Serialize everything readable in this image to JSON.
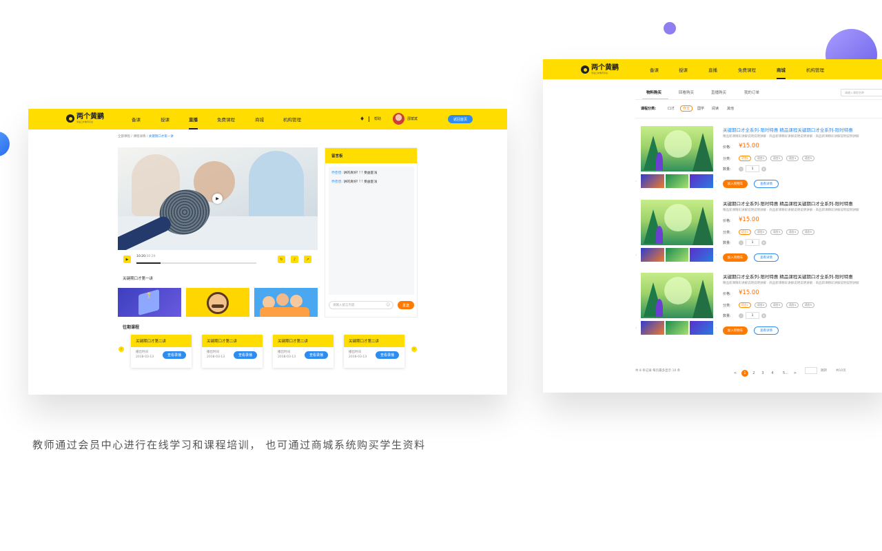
{
  "brand": {
    "name": "两个黄鹂",
    "slogan": "专注口才教育平台"
  },
  "colors": {
    "brand_yellow": "#ffdd00",
    "accent_blue": "#2d8cf0",
    "accent_orange": "#ff7a00",
    "price_orange": "#ff6a00"
  },
  "screen1": {
    "nav": {
      "items": [
        "备课",
        "授课",
        "直播",
        "免费课程",
        "商城",
        "机构管理"
      ],
      "active": "直播",
      "bell_icon": "bell-icon",
      "help": "帮助",
      "user_name": "邵斌斌",
      "home_button": "返回首页"
    },
    "breadcrumb": {
      "items": [
        "全部课程",
        "课程详情"
      ],
      "current": "关键期口才第一讲"
    },
    "video": {
      "time_current": "10:20",
      "time_total": "30:29",
      "progress": 0.2
    },
    "lesson_title": "关键期口才第一讲",
    "message_board": {
      "title": "留言板",
      "messages": [
        {
          "user": "乔佳佳:",
          "text": "讲的真好! ! ! 受益匪浅"
        },
        {
          "user": "乔佳佳:",
          "text": "讲的真好! ! ! 受益匪浅"
        }
      ],
      "input_placeholder": "请输入留言内容",
      "send_button": "发送"
    },
    "past_courses": {
      "title": "往期课程",
      "cards": [
        {
          "title": "关键期口才第二讲",
          "meta_label": "播出时间",
          "date": "2018-03-13",
          "button": "查看录播"
        },
        {
          "title": "关键期口才第二讲",
          "meta_label": "播出时间",
          "date": "2018-03-13",
          "button": "查看录播"
        },
        {
          "title": "关键期口才第二讲",
          "meta_label": "播出时间",
          "date": "2018-03-13",
          "button": "查看录播"
        },
        {
          "title": "关键期口才第二讲",
          "meta_label": "播出时间",
          "date": "2018-03-13",
          "button": "查看录播"
        }
      ]
    }
  },
  "screen2": {
    "nav": {
      "items": [
        "备课",
        "授课",
        "直播",
        "免费课程",
        "商城",
        "机构管理"
      ],
      "active": "商城"
    },
    "tabs": [
      "物料购买",
      "回看购买",
      "直播购买",
      "我的订单"
    ],
    "active_tab": "物料购买",
    "search_placeholder": "请输入课程名称",
    "category": {
      "label": "课程分类:",
      "items": [
        "口才",
        "作文",
        "国学",
        "阅读",
        "其他"
      ],
      "active": "作文"
    },
    "products": [
      {
        "title": "关键期口才全系列-限时特惠  精品课程关键期口才全系列-限时特惠",
        "highlight": true,
        "desc": "精品新课精彩讲解说明说明讲解 · 商品新课精彩讲解说明说明讲解 · 商品新课精彩讲解说明说明讲解",
        "price_label": "价格:",
        "price": "¥15.00",
        "tags_label": "分类:",
        "tags": [
          "语言1",
          "语言2",
          "语言3",
          "语言4",
          "语言5"
        ],
        "active_tag": "语言1",
        "qty_label": "数量:",
        "qty": "1",
        "add_cart": "加入购物车",
        "detail": "查看详情"
      },
      {
        "title": "关键期口才全系列-限时特惠  精品课程关键期口才全系列-限时特惠",
        "highlight": false,
        "desc": "精品新课精彩讲解说明说明讲解 · 商品新课精彩讲解说明说明讲解 · 商品新课精彩讲解说明说明讲解",
        "price_label": "价格:",
        "price": "¥15.00",
        "tags_label": "分类:",
        "tags": [
          "语言1",
          "语言2",
          "语言3",
          "语言4",
          "语言5"
        ],
        "active_tag": "语言1",
        "qty_label": "数量:",
        "qty": "1",
        "add_cart": "加入购物车",
        "detail": "查看详情"
      },
      {
        "title": "关键期口才全系列-限时特惠  精品课程关键期口才全系列-限时特惠",
        "highlight": false,
        "desc": "精品新课精彩讲解说明说明讲解 · 商品新课精彩讲解说明说明讲解 · 商品新课精彩讲解说明说明讲解",
        "price_label": "价格:",
        "price": "¥15.00",
        "tags_label": "分类:",
        "tags": [
          "语言1",
          "语言2",
          "语言3",
          "语言4",
          "语言5"
        ],
        "active_tag": "语言1",
        "qty_label": "数量:",
        "qty": "1",
        "add_cart": "加入购物车",
        "detail": "查看详情"
      }
    ],
    "pagination": {
      "summary": "共 8 条记录 每页最多显示 10 条",
      "prev": "<",
      "pages": [
        "1",
        "2",
        "3",
        "4",
        "5..."
      ],
      "next": ">",
      "current": "1",
      "goto": "跳转",
      "total": "共10页"
    }
  },
  "caption": "教师通过会员中心进行在线学习和课程培训，  也可通过商城系统购买学生资料"
}
